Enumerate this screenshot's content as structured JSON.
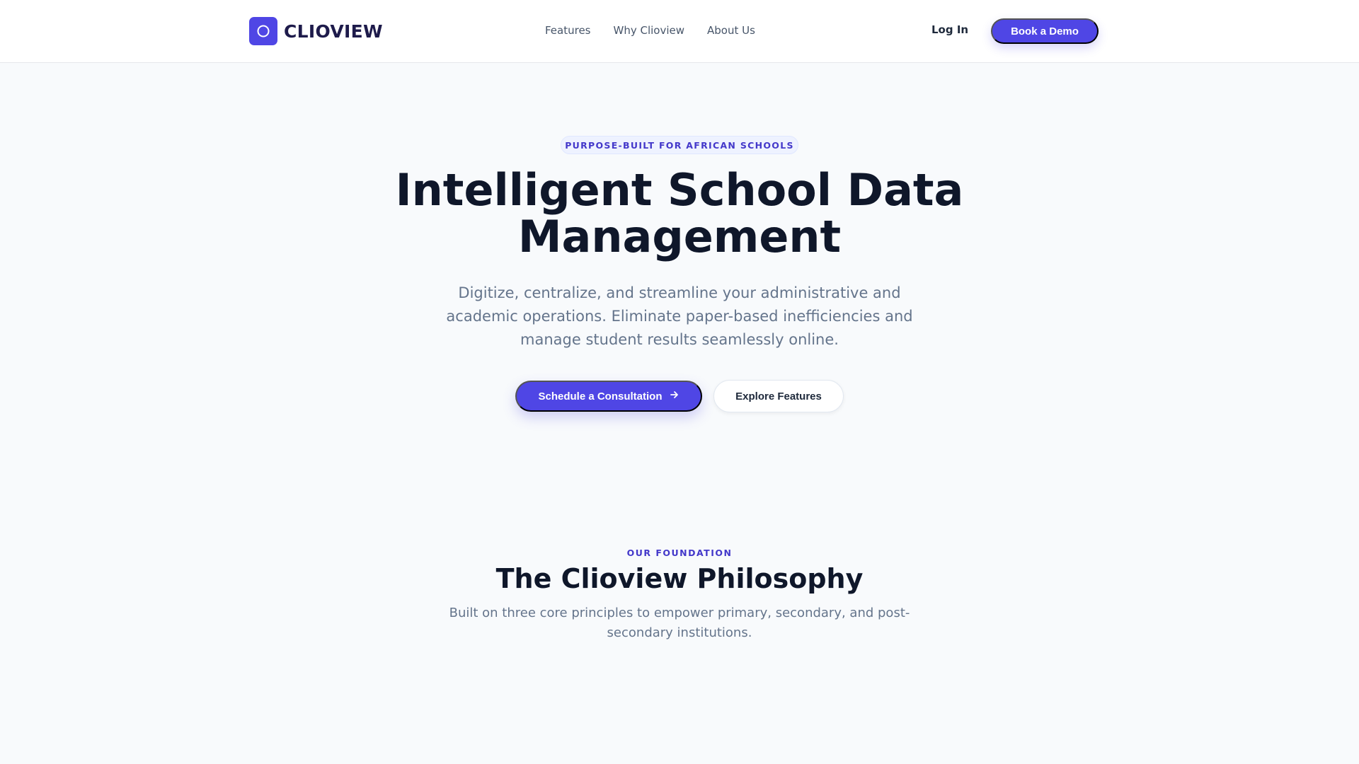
{
  "navbar": {
    "brand": "CLIOVIEW",
    "links": [
      "Features",
      "Why Clioview",
      "About Us"
    ],
    "login": "Log In",
    "cta": "Book a Demo"
  },
  "hero": {
    "badge": "PURPOSE-BUILT FOR AFRICAN SCHOOLS",
    "title": "Intelligent School Data Management",
    "subtitle": "Digitize, centralize, and streamline your administrative and academic operations. Eliminate paper-based inefficiencies and manage student results seamlessly online.",
    "primary_button": "Schedule a Consultation",
    "secondary_button": "Explore Features"
  },
  "philosophy": {
    "eyebrow": "OUR FOUNDATION",
    "title": "The Clioview Philosophy",
    "subtitle": "Built on three core principles to empower primary, secondary, and post-secondary institutions."
  },
  "colors": {
    "accent": "#4f46e5",
    "heading": "#0f172a",
    "body_text": "#64748b",
    "background": "#f8fafc"
  },
  "icons": {
    "brand_logo": "circle-logo-icon",
    "primary_button": "arrow-right-icon"
  }
}
